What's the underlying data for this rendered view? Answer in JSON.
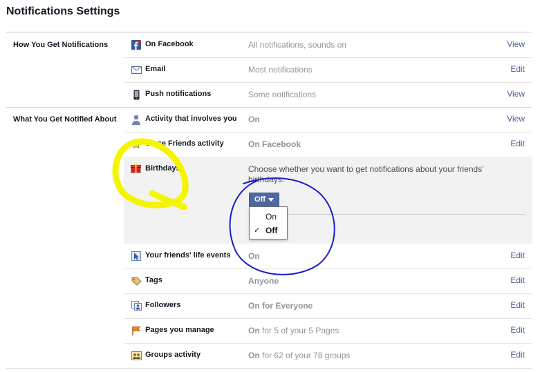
{
  "page": {
    "title": "Notifications Settings"
  },
  "sections": [
    {
      "label": "How You Get Notifications"
    },
    {
      "label": "What You Get Notified About"
    }
  ],
  "how_rows": [
    {
      "label": "On Facebook",
      "value": "All notifications, sounds on",
      "action": "View",
      "icon": "facebook-icon"
    },
    {
      "label": "Email",
      "value": "Most notifications",
      "action": "Edit",
      "icon": "envelope-icon"
    },
    {
      "label": "Push notifications",
      "value": "Some notifications",
      "action": "View",
      "icon": "phone-icon"
    }
  ],
  "what_rows_top": [
    {
      "label": "Activity that involves you",
      "value": "On",
      "action": "View",
      "icon": "person-icon"
    },
    {
      "label": "Close Friends activity",
      "value": "On Facebook",
      "action": "Edit",
      "icon": "star-icon"
    }
  ],
  "birthdays": {
    "label": "Birthdays",
    "icon": "gift-icon",
    "description": "Choose whether you want to get notifications about your friends' birthdays.",
    "dropdown": {
      "selected": "Off",
      "options": [
        "On",
        "Off"
      ]
    }
  },
  "what_rows_bottom": [
    {
      "label": "Your friends' life events",
      "value_bold": "On",
      "value_rest": "",
      "action": "Edit",
      "icon": "flag-pointer-icon"
    },
    {
      "label": "Tags",
      "value_bold": "Anyone",
      "value_rest": "",
      "action": "Edit",
      "icon": "tag-icon"
    },
    {
      "label": "Followers",
      "value_bold": "On for Everyone",
      "value_rest": "",
      "action": "Edit",
      "icon": "followers-icon"
    },
    {
      "label": "Pages you manage",
      "value_bold": "On",
      "value_rest": " for 5 of your 5 Pages",
      "action": "Edit",
      "icon": "pages-flag-icon"
    },
    {
      "label": "Groups activity",
      "value_bold": "On",
      "value_rest": " for 62 of your 78 groups",
      "action": "Edit",
      "icon": "groups-icon"
    }
  ],
  "colors": {
    "link": "#4b5f8f",
    "muted": "#90949c",
    "yellow_mark": "#f5f500",
    "blue_mark": "#1a1acc",
    "button": "#4e69a2"
  }
}
